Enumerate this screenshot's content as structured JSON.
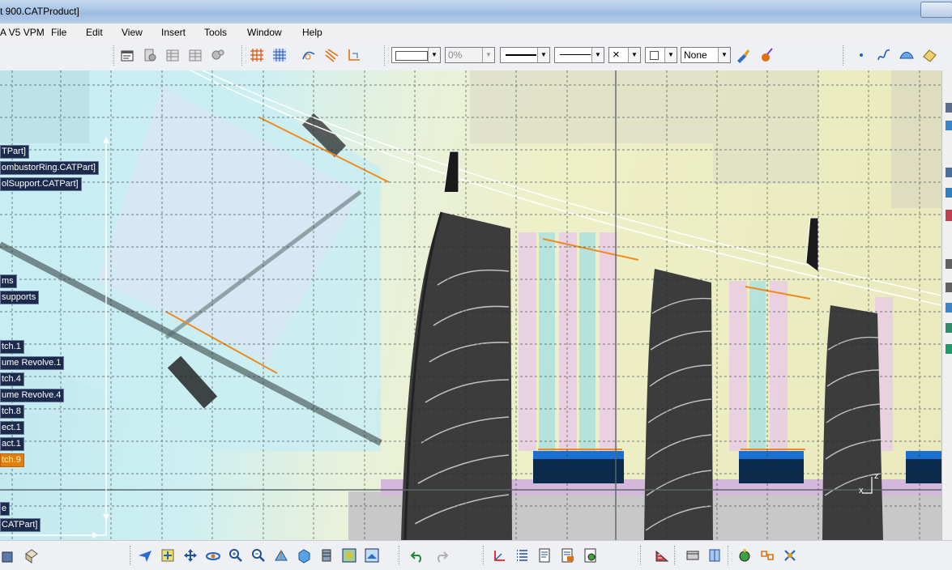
{
  "window": {
    "title": "t 900.CATProduct]"
  },
  "menubar": {
    "app_label": "A V5 VPM",
    "items": [
      "File",
      "Edit",
      "View",
      "Insert",
      "Tools",
      "Window",
      "Help"
    ]
  },
  "toolbar": {
    "color_dropdown": "",
    "transparency_dropdown": "0%",
    "linetype_dropdown": "",
    "lineweight_dropdown": "",
    "point_dropdown": "×",
    "layer_dropdown": "",
    "none_dropdown": "None",
    "icons": [
      "properties-icon",
      "catalog-icon",
      "table-icon",
      "sheet-icon",
      "gears-icon",
      "grid-icon",
      "snap-grid-icon",
      "sketch-analysis-icon",
      "constraint-icon",
      "axis-icon",
      "painter-icon",
      "apply-material-icon",
      "point-icon",
      "curve-icon",
      "surface-icon",
      "hide-icon"
    ]
  },
  "tree": {
    "items": [
      {
        "label": "TPart]",
        "selected": false
      },
      {
        "label": "ombustorRing.CATPart]",
        "selected": false
      },
      {
        "label": "olSupport.CATPart]",
        "selected": false
      },
      {
        "label": "ms",
        "selected": false
      },
      {
        "label": "supports",
        "selected": false
      },
      {
        "label": "tch.1",
        "selected": false
      },
      {
        "label": "ume Revolve.1",
        "selected": false
      },
      {
        "label": "tch.4",
        "selected": false
      },
      {
        "label": "ume Revolve.4",
        "selected": false
      },
      {
        "label": "tch.8",
        "selected": false
      },
      {
        "label": "ect.1",
        "selected": false
      },
      {
        "label": "act.1",
        "selected": false
      },
      {
        "label": "tch.9",
        "selected": true
      },
      {
        "label": "e",
        "selected": false
      },
      {
        "label": "CATPart]",
        "selected": false
      }
    ]
  },
  "compass": {
    "z_label": "z",
    "x_label": "x"
  },
  "bottom_toolbar": {
    "icons": [
      "assembly-icon",
      "product-icon",
      "fly-mode-icon",
      "fit-all-icon",
      "pan-icon",
      "rotate-icon",
      "zoom-in-icon",
      "zoom-out-icon",
      "normal-view-icon",
      "iso-view-icon",
      "hide-show-icon",
      "swap-space-icon",
      "shading-icon",
      "undo-icon",
      "redo-icon",
      "axis-system-icon",
      "list-icon",
      "report-icon",
      "report-2-icon",
      "analysis-icon",
      "measure-icon",
      "catalog-2-icon",
      "section-icon",
      "apply-material-2-icon",
      "constraints-icon",
      "compass-icon"
    ]
  },
  "colors": {
    "selected_item": "#e07e10",
    "tree_item_bg": "#1c2a4c",
    "blade": "#3a3a3a",
    "slot_blue": "#1a6fd0",
    "slot_dark": "#0c2a4c",
    "orange_line": "#f08a20"
  }
}
